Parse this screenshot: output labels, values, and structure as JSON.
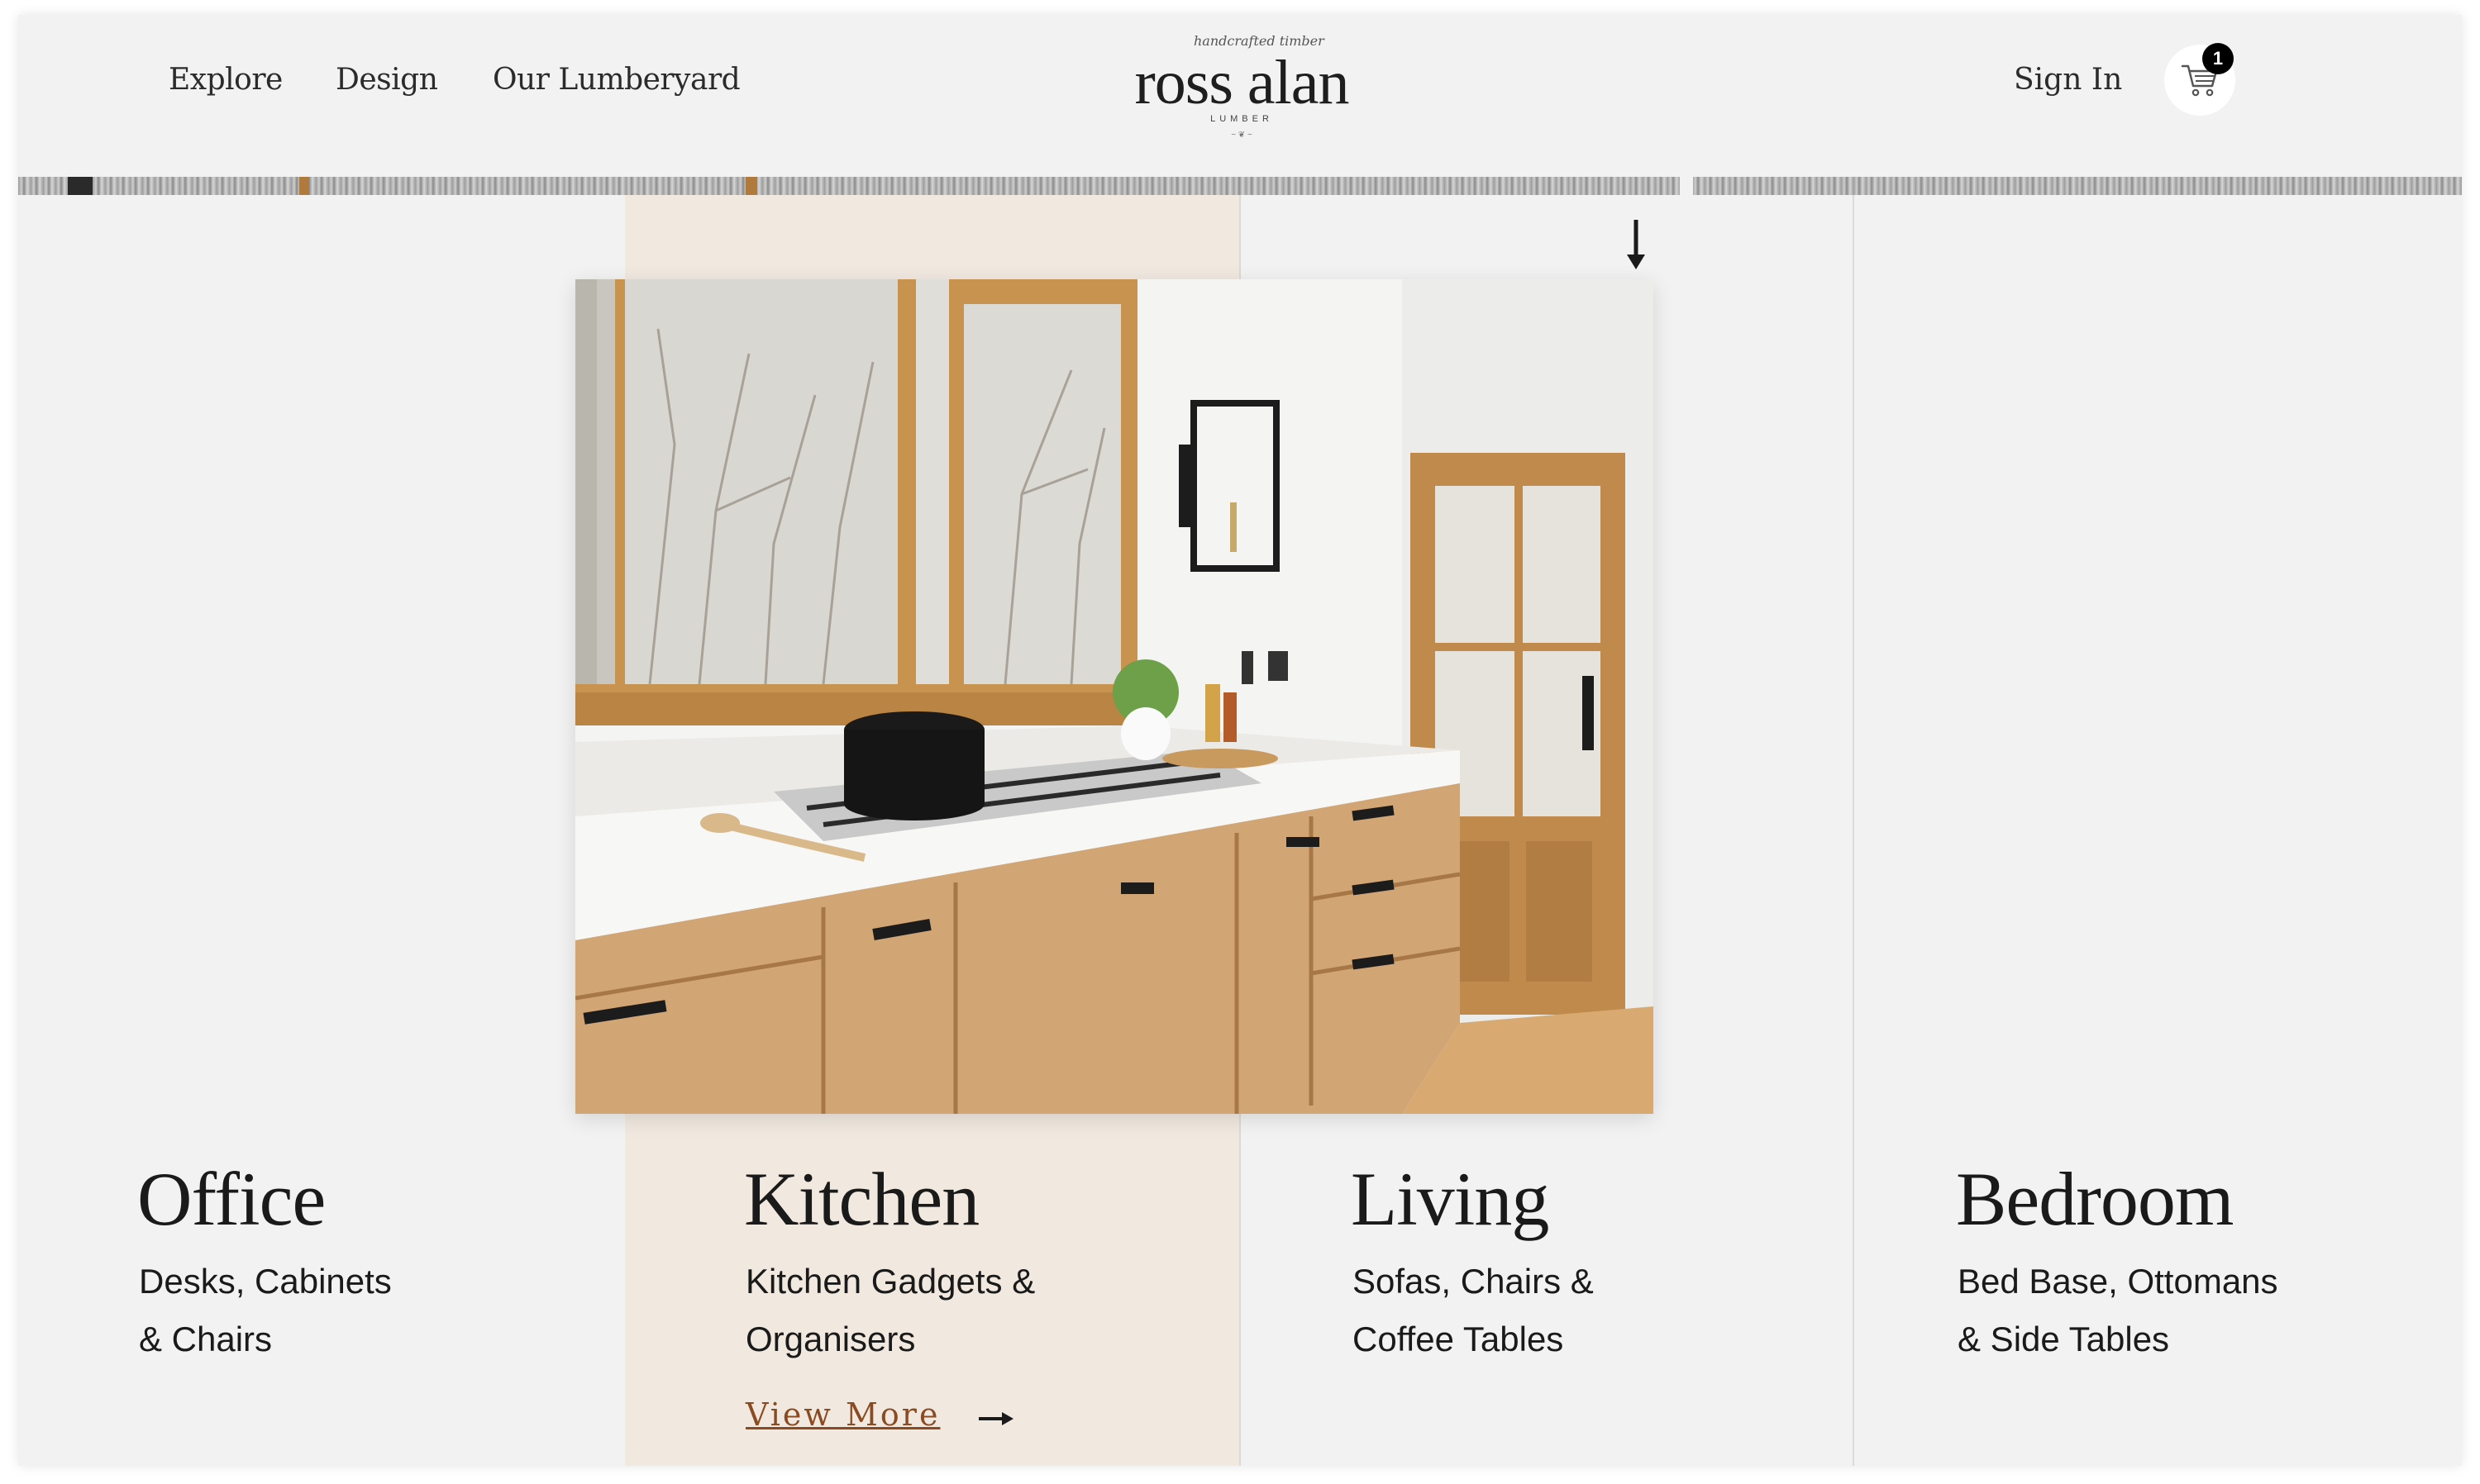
{
  "nav": {
    "links": [
      {
        "label": "Explore"
      },
      {
        "label": "Design"
      },
      {
        "label": "Our Lumberyard"
      }
    ],
    "sign_in": "Sign In",
    "cart_count": "1",
    "cart_icon": "cart-icon"
  },
  "logo": {
    "script": "handcrafted timber",
    "main": "ross alan",
    "sub": "LUMBER"
  },
  "hero_image": "kitchen-photo",
  "categories": [
    {
      "title": "Office",
      "line1": "Desks, Cabinets",
      "line2": "& Chairs"
    },
    {
      "title": "Kitchen",
      "line1": "Kitchen Gadgets &",
      "line2": "Organisers",
      "link": "View More"
    },
    {
      "title": "Living",
      "line1": "Sofas, Chairs &",
      "line2": "Coffee Tables"
    },
    {
      "title": "Bedroom",
      "line1": "Bed Base, Ottomans",
      "line2": "& Side Tables"
    }
  ],
  "colors": {
    "background": "#f2f2f2",
    "highlight_column": "#f1e9e0",
    "accent_link": "#8a4a22",
    "text": "#1a1a1a"
  }
}
